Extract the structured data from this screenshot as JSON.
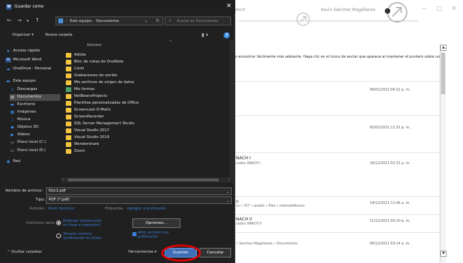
{
  "background_window": {
    "title": "Word",
    "user": "Kevin Sánchez Magallanes",
    "hint_text": "s encontrar fácilmente más adelante. Haga clic en el icono de anclar que aparece al mantener el puntero sobre una",
    "rows": [
      {
        "title": "",
        "subtitle": "",
        "date": "06/01/2022 04:32 p. m."
      },
      {
        "title": "",
        "subtitle": "",
        "date": "05/01/2022 11:31 p. m."
      },
      {
        "title": "NACH I",
        "subtitle": "cados UNACH I",
        "date": "29/12/2021 02:31 p. m."
      },
      {
        "title": "o",
        "subtitle": "cs » 257 » assets » files » matrizdeNuevo",
        "date": "14/12/2021 11:46 a. m."
      },
      {
        "title": "NACH II",
        "subtitle": "cados UNACH II",
        "date": "11/12/2021 09:10 p. m."
      },
      {
        "title": "",
        "subtitle": "» Sánchez Magallanes » Documentos",
        "date": "09/12/2021 03:14 a. m."
      }
    ]
  },
  "dialog": {
    "title": "Guardar como",
    "breadcrumb": [
      "Este equipo",
      "Documentos"
    ],
    "search_placeholder": "Buscar en Documentos",
    "toolbar": {
      "organize": "Organizar ▾",
      "new_folder": "Nueva carpeta"
    },
    "nav_items": [
      {
        "label": "Acceso rápido",
        "icon": "★",
        "color": "#3b8ee8"
      },
      {
        "label": "Microsoft Word",
        "icon": "W",
        "color": "#2b579a"
      },
      {
        "label": "OneDrive - Personal",
        "icon": "☁",
        "color": "#3b8ee8"
      },
      {
        "label": "Este equipo",
        "icon": "▬",
        "color": "#3b8ee8"
      },
      {
        "label": "Descargas",
        "icon": "↓",
        "color": "#3b8ee8"
      },
      {
        "label": "Documentos",
        "icon": "▤",
        "color": "#dcdcdc"
      },
      {
        "label": "Escritorio",
        "icon": "▬",
        "color": "#3b8ee8"
      },
      {
        "label": "Imágenes",
        "icon": "▦",
        "color": "#3b8ee8"
      },
      {
        "label": "Música",
        "icon": "♪",
        "color": "#3b8ee8"
      },
      {
        "label": "Objetos 3D",
        "icon": "◆",
        "color": "#3b8ee8"
      },
      {
        "label": "Videos",
        "icon": "▶",
        "color": "#3b8ee8"
      },
      {
        "label": "Disco local (C:)",
        "icon": "▭",
        "color": "#bdbdbd"
      },
      {
        "label": "Disco local (E:)",
        "icon": "▭",
        "color": "#bdbdbd"
      },
      {
        "label": "Red",
        "icon": "◉",
        "color": "#3b8ee8"
      }
    ],
    "column_name": "Nombre",
    "files": [
      "Adobe",
      "Bloc de notas de OneNote",
      "Corel",
      "Grabaciones de sonido",
      "Mis archivos de origen de datos",
      "Mis formas",
      "NetBeansProjects",
      "Plantillas personalizadas de Office",
      "Screencast-O-Matic",
      "ScreenRecorder",
      "SQL Server Management Studio",
      "Visual Studio 2017",
      "Visual Studio 2019",
      "Wondershare",
      "Zoom"
    ],
    "form": {
      "filename_label": "Nombre de archivo:",
      "filename_value": "Doc1.pdf",
      "type_label": "Tipo:",
      "type_value": "PDF (*.pdf)",
      "authors_label": "Autores:",
      "authors_value": "Kevin Sánchez",
      "tags_label": "Etiquetas:",
      "tags_value": "Agregar una etiqueta",
      "optimize_label": "Optimizar para:",
      "option1": "Estándar (publicación en línea e impresión)",
      "option2": "Tamaño mínimo (publicación en línea)",
      "options_button": "Opciones...",
      "open_after": "Abrir archivo tras publicación",
      "hide_folders": "⌃  Ocultar carpetas",
      "tools": "Herramientas ▾",
      "save_button": "Guardar",
      "cancel_button": "Cancelar"
    }
  }
}
